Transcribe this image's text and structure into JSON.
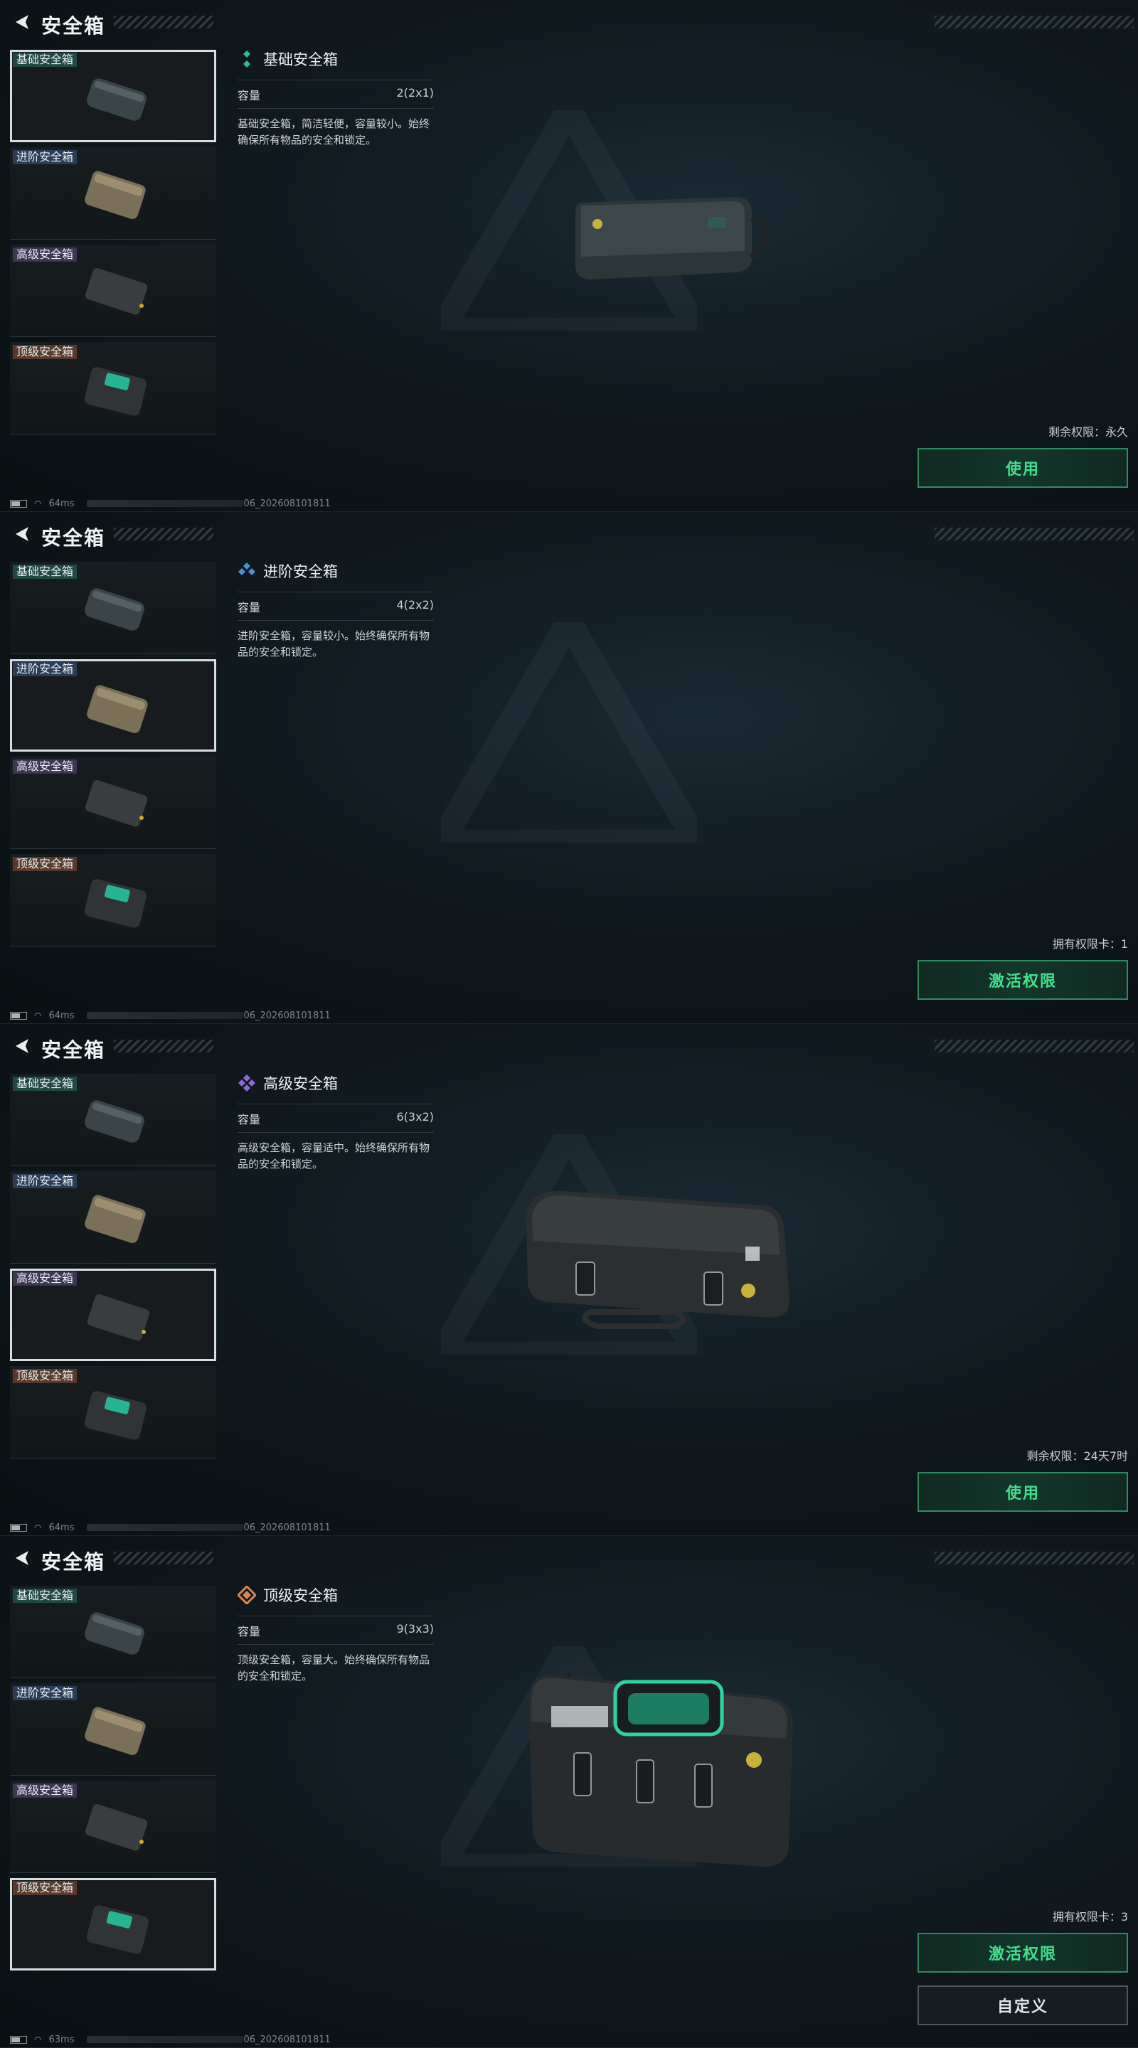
{
  "panels": [
    {
      "title": "安全箱",
      "selected": 0,
      "items": [
        "基础安全箱",
        "进阶安全箱",
        "高级安全箱",
        "顶级安全箱"
      ],
      "detail": {
        "name": "基础安全箱",
        "rarity": "basic",
        "capacity_label": "容量",
        "capacity_value": "2(2x1)",
        "description": "基础安全箱，简洁轻便，容量较小。始终确保所有物品的安全和锁定。"
      },
      "remain_text": "剩余权限：永久",
      "buttons": [
        "使用"
      ],
      "status": {
        "ping": "64ms",
        "build": "06_202608101811"
      }
    },
    {
      "title": "安全箱",
      "selected": 1,
      "items": [
        "基础安全箱",
        "进阶安全箱",
        "高级安全箱",
        "顶级安全箱"
      ],
      "detail": {
        "name": "进阶安全箱",
        "rarity": "advanced",
        "capacity_label": "容量",
        "capacity_value": "4(2x2)",
        "description": "进阶安全箱，容量较小。始终确保所有物品的安全和锁定。"
      },
      "remain_text": "拥有权限卡：1",
      "buttons": [
        "激活权限"
      ],
      "status": {
        "ping": "64ms",
        "build": "06_202608101811"
      }
    },
    {
      "title": "安全箱",
      "selected": 2,
      "items": [
        "基础安全箱",
        "进阶安全箱",
        "高级安全箱",
        "顶级安全箱"
      ],
      "detail": {
        "name": "高级安全箱",
        "rarity": "senior",
        "capacity_label": "容量",
        "capacity_value": "6(3x2)",
        "description": "高级安全箱，容量适中。始终确保所有物品的安全和锁定。"
      },
      "remain_text": "剩余权限：24天7时",
      "buttons": [
        "使用"
      ],
      "status": {
        "ping": "64ms",
        "build": "06_202608101811"
      }
    },
    {
      "title": "安全箱",
      "selected": 3,
      "items": [
        "基础安全箱",
        "进阶安全箱",
        "高级安全箱",
        "顶级安全箱"
      ],
      "detail": {
        "name": "顶级安全箱",
        "rarity": "top",
        "capacity_label": "容量",
        "capacity_value": "9(3x3)",
        "description": "顶级安全箱，容量大。始终确保所有物品的安全和锁定。"
      },
      "remain_text": "拥有权限卡：3",
      "buttons": [
        "激活权限",
        "自定义"
      ],
      "status": {
        "ping": "63ms",
        "build": "06_202608101811"
      }
    }
  ],
  "colors": {
    "accent_green": "#3ee28b",
    "button_border": "#2e8a5f",
    "rarity_basic": "#2fbf8f",
    "rarity_advanced": "#4a90d9",
    "rarity_senior": "#8e6ad8",
    "rarity_top": "#d9894a"
  },
  "icons": {
    "back": "back-arrow-icon",
    "wifi": "wifi-icon",
    "battery": "battery-icon"
  }
}
